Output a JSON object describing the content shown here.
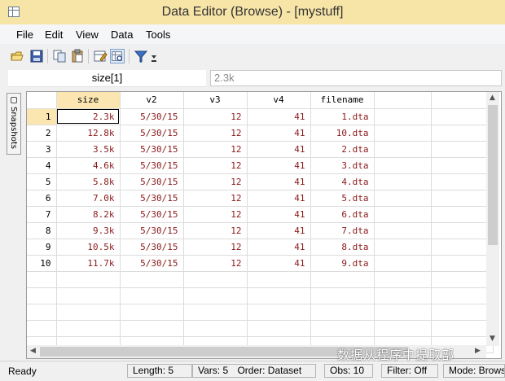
{
  "window": {
    "title": "Data Editor (Browse) - [mystuff]"
  },
  "menu": [
    "File",
    "Edit",
    "View",
    "Data",
    "Tools"
  ],
  "toolbar": {
    "icons": [
      "open-icon",
      "save-icon",
      "copy-icon",
      "paste-icon",
      "edit-mode-icon",
      "browse-mode-icon",
      "filter-icon",
      "more-icon"
    ]
  },
  "varbar": {
    "name": "size[1]",
    "value": "2.3k"
  },
  "snapshots_label": "Snapshots",
  "grid": {
    "columns": [
      "size",
      "v2",
      "v3",
      "v4",
      "filename"
    ],
    "rows": [
      {
        "n": "1",
        "cells": [
          "2.3k",
          "5/30/15",
          "12",
          "41",
          "1.dta"
        ]
      },
      {
        "n": "2",
        "cells": [
          "12.8k",
          "5/30/15",
          "12",
          "41",
          "10.dta"
        ]
      },
      {
        "n": "3",
        "cells": [
          "3.5k",
          "5/30/15",
          "12",
          "41",
          "2.dta"
        ]
      },
      {
        "n": "4",
        "cells": [
          "4.6k",
          "5/30/15",
          "12",
          "41",
          "3.dta"
        ]
      },
      {
        "n": "5",
        "cells": [
          "5.8k",
          "5/30/15",
          "12",
          "41",
          "4.dta"
        ]
      },
      {
        "n": "6",
        "cells": [
          "7.0k",
          "5/30/15",
          "12",
          "41",
          "5.dta"
        ]
      },
      {
        "n": "7",
        "cells": [
          "8.2k",
          "5/30/15",
          "12",
          "41",
          "6.dta"
        ]
      },
      {
        "n": "8",
        "cells": [
          "9.3k",
          "5/30/15",
          "12",
          "41",
          "7.dta"
        ]
      },
      {
        "n": "9",
        "cells": [
          "10.5k",
          "5/30/15",
          "12",
          "41",
          "8.dta"
        ]
      },
      {
        "n": "10",
        "cells": [
          "11.7k",
          "5/30/15",
          "12",
          "41",
          "9.dta"
        ]
      }
    ]
  },
  "status": {
    "ready": "Ready",
    "length": "Length: 5",
    "vars": "Vars: 5",
    "order": "Order: Dataset",
    "obs": "Obs: 10",
    "filter": "Filter: Off",
    "mode": "Mode: Browse"
  },
  "watermark": "数据从程序中提取部"
}
